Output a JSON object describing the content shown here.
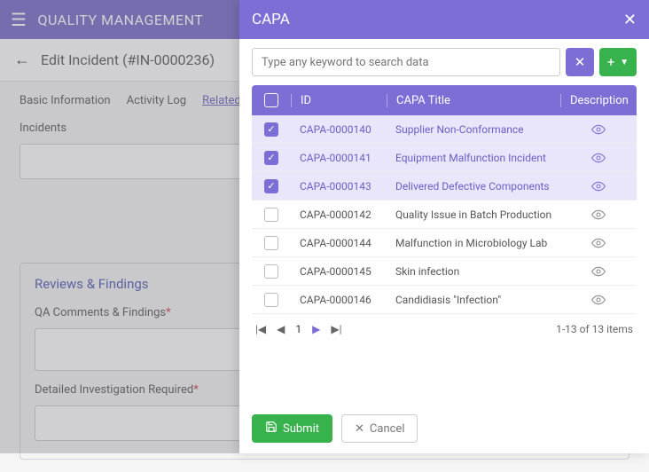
{
  "bg": {
    "app_title": "QUALITY MANAGEMENT",
    "page_title": "Edit Incident (#IN-0000236)",
    "tabs": [
      "Basic Information",
      "Activity Log",
      "Related "
    ],
    "incidents_label": "Incidents",
    "section_title": "Reviews & Findings",
    "qa_label": "QA Comments & Findings",
    "detailed_label": "Detailed Investigation Required"
  },
  "panel": {
    "title": "CAPA",
    "search_placeholder": "Type any keyword to search data",
    "columns": {
      "id": "ID",
      "title": "CAPA Title",
      "desc": "Description"
    },
    "rows": [
      {
        "id": "CAPA-0000140",
        "title": "Supplier Non-Conformance",
        "selected": true
      },
      {
        "id": "CAPA-0000141",
        "title": "Equipment Malfunction Incident",
        "selected": true
      },
      {
        "id": "CAPA-0000143",
        "title": "Delivered Defective Components",
        "selected": true
      },
      {
        "id": "CAPA-0000142",
        "title": "Quality Issue in Batch Production",
        "selected": false
      },
      {
        "id": "CAPA-0000144",
        "title": "Malfunction in Microbiology Lab",
        "selected": false
      },
      {
        "id": "CAPA-0000145",
        "title": "Skin infection",
        "selected": false
      },
      {
        "id": "CAPA-0000146",
        "title": "Candidiasis \"Infection\"",
        "selected": false
      }
    ],
    "pager": {
      "page": "1",
      "summary": "1-13 of 13 items"
    },
    "buttons": {
      "submit": "Submit",
      "cancel": "Cancel"
    }
  }
}
